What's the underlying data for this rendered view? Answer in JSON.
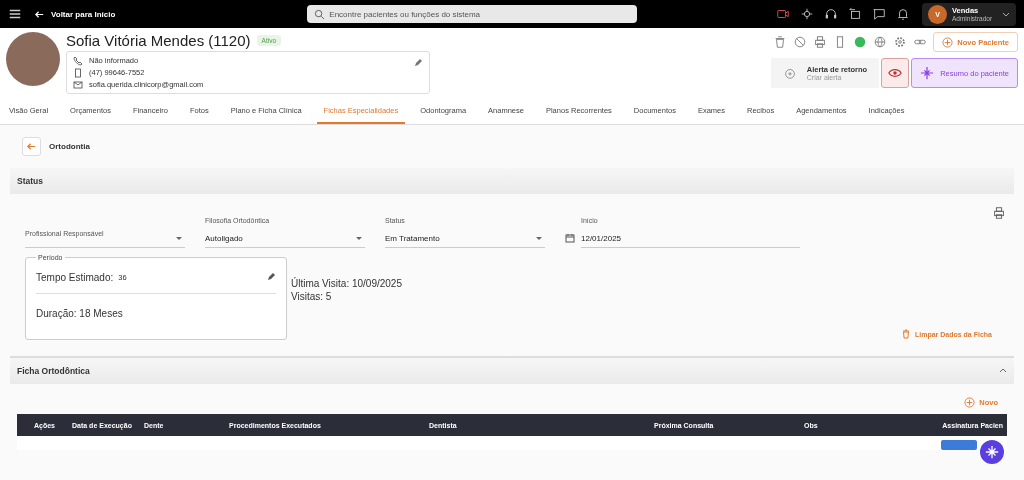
{
  "topbar": {
    "back": "Voltar para Início",
    "search_placeholder": "Encontre pacientes ou funções do sistema",
    "user": {
      "initial": "V",
      "name": "Vendas",
      "role": "Administrador"
    }
  },
  "patient": {
    "name": "Sofia Vitória Mendes (1120)",
    "status": "Ativo",
    "phone": "Não informado",
    "mobile": "(47) 99646-7552",
    "email": "sofia.querida.clinicorp@gmail.com"
  },
  "actions": {
    "new_patient": "Novo Paciente",
    "alert_title": "Alerta de retorno",
    "alert_sub": "Criar alerta",
    "summary": "Resumo do paciente"
  },
  "tabs": [
    {
      "label": "Visão Geral",
      "selected": false
    },
    {
      "label": "Orçamentos",
      "selected": false
    },
    {
      "label": "Financeiro",
      "selected": false
    },
    {
      "label": "Fotos",
      "selected": false
    },
    {
      "label": "Plano e Ficha Clínica",
      "selected": false
    },
    {
      "label": "Fichas Especialidades",
      "selected": true
    },
    {
      "label": "Odontograma",
      "selected": false
    },
    {
      "label": "Anamnese",
      "selected": false
    },
    {
      "label": "Planos Recorrentes",
      "selected": false
    },
    {
      "label": "Documentos",
      "selected": false
    },
    {
      "label": "Exames",
      "selected": false
    },
    {
      "label": "Recibos",
      "selected": false
    },
    {
      "label": "Agendamentos",
      "selected": false
    },
    {
      "label": "Indicações",
      "selected": false
    }
  ],
  "page_title": "Ortodontia",
  "status_section": {
    "title": "Status",
    "fields": [
      {
        "label": "Profissional Responsável",
        "kind": "select"
      },
      {
        "label": "Filosofia Ortodôntica",
        "value": "Autoligado",
        "kind": "select"
      },
      {
        "label": "Status",
        "value": "Em Tratamento",
        "kind": "select"
      },
      {
        "label": "Início",
        "value": "12/01/2025",
        "kind": "date"
      }
    ],
    "period": {
      "legend": "Período",
      "estimated_label": "Tempo Estimado:",
      "estimated_value": "36",
      "duration": "Duração: 18 Meses"
    },
    "last_visit": "Última Visita: 10/09/2025",
    "visits": "Visitas: 5",
    "clear": "Limpar Dados da Ficha"
  },
  "ficha": {
    "title": "Ficha Ortodôntica",
    "new": "Novo",
    "columns": [
      "Ações",
      "Data de Execução",
      "Dente",
      "Procedimentos Executados",
      "Dentista",
      "Próxima Consulta",
      "Obs",
      "Assinatura Pacien"
    ]
  }
}
